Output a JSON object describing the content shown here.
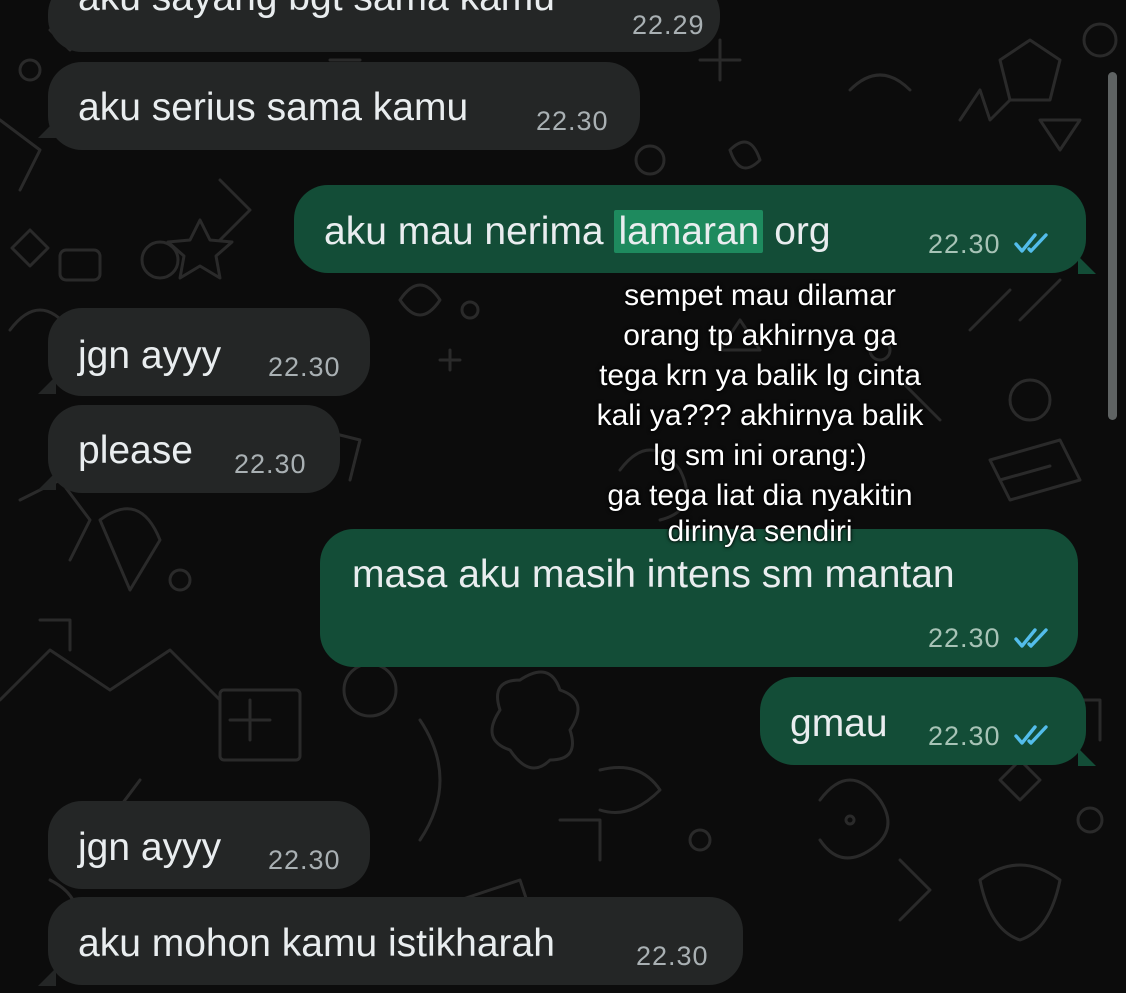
{
  "chat": {
    "messages": [
      {
        "direction": "incoming",
        "text": "aku sayang bgt sama kamu",
        "time": "22.29"
      },
      {
        "direction": "incoming",
        "text": "aku serius sama kamu",
        "time": "22.30"
      },
      {
        "direction": "outgoing",
        "text_before": "aku mau nerima ",
        "highlight": "lamaran",
        "text_after": " org",
        "time": "22.30",
        "status": "read"
      },
      {
        "direction": "incoming",
        "text": "jgn ayyy",
        "time": "22.30"
      },
      {
        "direction": "incoming",
        "text": "please",
        "time": "22.30"
      },
      {
        "direction": "outgoing",
        "text": "masa aku masih intens sm mantan",
        "time": "22.30",
        "status": "read"
      },
      {
        "direction": "outgoing",
        "text": "gmau",
        "time": "22.30",
        "status": "read"
      },
      {
        "direction": "incoming",
        "text": "jgn ayyy",
        "time": "22.30"
      },
      {
        "direction": "incoming",
        "text": "aku mohon kamu istikharah",
        "time": "22.30"
      }
    ]
  },
  "caption": {
    "lines": [
      "sempet mau dilamar",
      "orang tp akhirnya ga",
      "tega krn ya balik lg cinta",
      "kali ya??? akhirnya balik",
      "lg sm ini orang:)",
      "ga tega liat dia nyakitin",
      "dirinya sendiri"
    ]
  },
  "colors": {
    "background": "#0c0c0c",
    "incoming_bubble": "#242626",
    "outgoing_bubble": "#134d37",
    "read_ticks": "#53bdeb",
    "highlight": "#1e8a5e"
  },
  "icons": [
    "double-check-read-icon",
    "chat-doodle-wallpaper"
  ]
}
